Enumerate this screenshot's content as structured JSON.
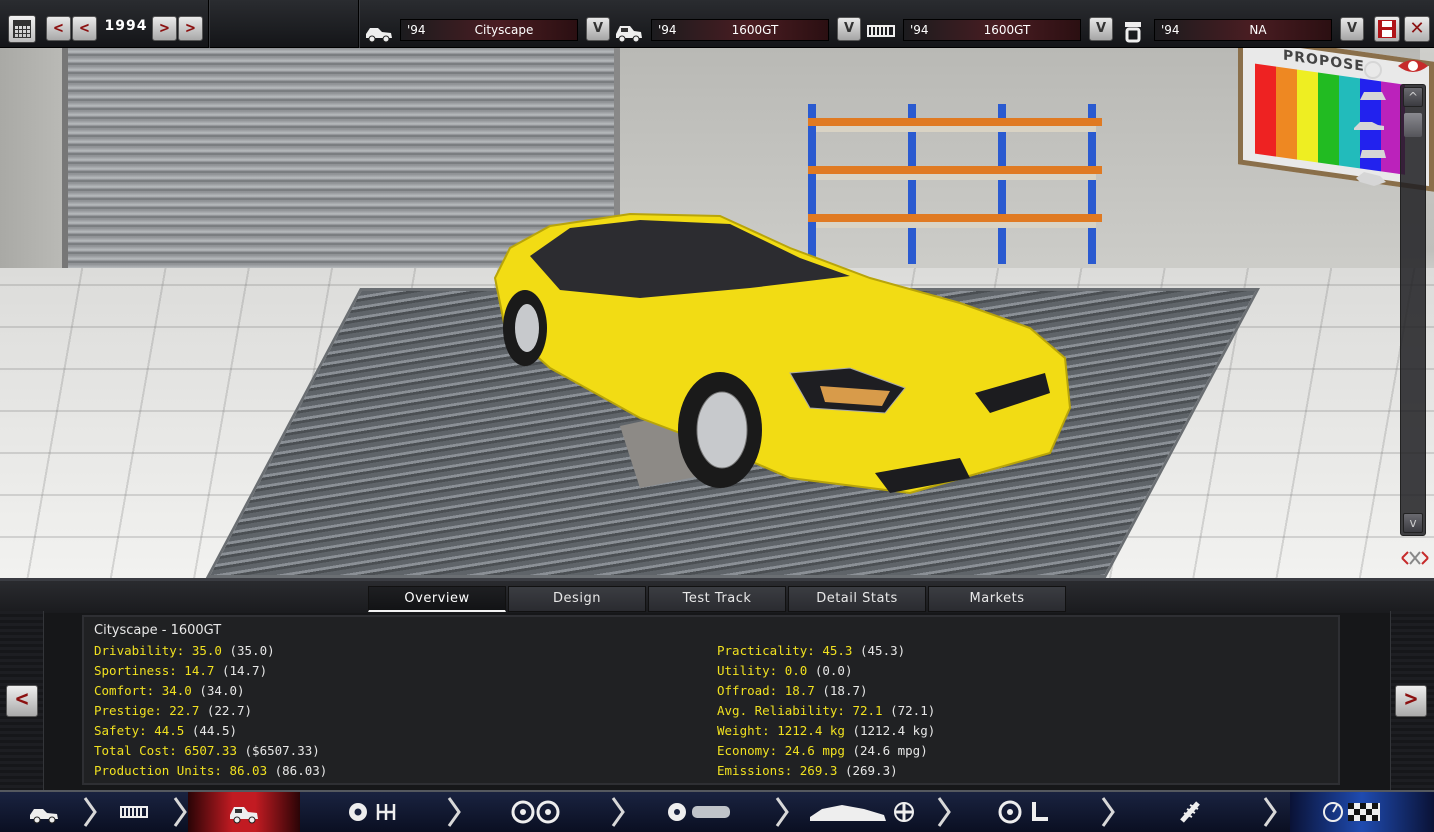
{
  "toolbar": {
    "year": "1994",
    "prev_year_fast": "<",
    "prev_year": "<",
    "next_year": ">",
    "next_year_fast": ">",
    "selectors": [
      {
        "icon": "car-body-icon",
        "year": "'94",
        "name": "Cityscape",
        "v": "V"
      },
      {
        "icon": "trim-icon",
        "year": "'94",
        "name": "1600GT",
        "v": "V"
      },
      {
        "icon": "chassis-icon",
        "year": "'94",
        "name": "1600GT",
        "v": "V"
      },
      {
        "icon": "engine-icon",
        "year": "'94",
        "name": "NA",
        "v": "V"
      }
    ],
    "close_label": "✕"
  },
  "viewport": {
    "poster_text": "PROPOSE",
    "scroll_up": "^",
    "scroll_down": "v",
    "car_color": "#f2dc14"
  },
  "tabs": [
    {
      "label": "Overview",
      "active": true
    },
    {
      "label": "Design"
    },
    {
      "label": "Test Track"
    },
    {
      "label": "Detail Stats"
    },
    {
      "label": "Markets"
    }
  ],
  "panel": {
    "prev": "<",
    "next": ">",
    "title": "Cityscape - 1600GT",
    "stats_left": [
      {
        "k": "Drivability: 35.0",
        "p": " (35.0)"
      },
      {
        "k": "Sportiness: 14.7",
        "p": " (14.7)"
      },
      {
        "k": "Comfort: 34.0",
        "p": " (34.0)"
      },
      {
        "k": "Prestige: 22.7",
        "p": " (22.7)"
      },
      {
        "k": "Safety: 44.5",
        "p": " (44.5)"
      },
      {
        "k": "Total Cost: 6507.33",
        "p": " ($6507.33)"
      },
      {
        "k": "Production Units: 86.03",
        "p": " (86.03)"
      }
    ],
    "stats_right": [
      {
        "k": "Practicality: 45.3",
        "p": " (45.3)"
      },
      {
        "k": "Utility: 0.0",
        "p": " (0.0)"
      },
      {
        "k": "Offroad: 18.7",
        "p": " (18.7)"
      },
      {
        "k": "Avg. Reliability: 72.1",
        "p": " (72.1)"
      },
      {
        "k": "Weight: 1212.4 kg",
        "p": " (1212.4 kg)"
      },
      {
        "k": "Economy: 24.6 mpg",
        "p": " (24.6 mpg)"
      },
      {
        "k": "Emissions: 269.3",
        "p": " (269.3)"
      }
    ]
  },
  "bottom_nav": [
    {
      "name": "vehicle",
      "icon": "car-side-icon"
    },
    {
      "name": "chassis",
      "icon": "chassis-icon"
    },
    {
      "name": "body",
      "icon": "car-body-icon",
      "active": true
    },
    {
      "name": "engine-gearbox",
      "icon": "gear-shift-icon"
    },
    {
      "name": "wheels",
      "icon": "wheels-icon"
    },
    {
      "name": "tires-fuel",
      "icon": "tire-tank-icon"
    },
    {
      "name": "aero-cooling",
      "icon": "sports-car-fan-icon"
    },
    {
      "name": "interior",
      "icon": "steering-seat-icon"
    },
    {
      "name": "suspension",
      "icon": "shock-absorber-icon"
    },
    {
      "name": "testing",
      "icon": "gauge-flag-icon"
    }
  ],
  "colors": {
    "accent_red": "#8b1010",
    "stat_yellow": "#f0e020",
    "nav_active": "#c21b22",
    "nav_blue": "#1f4bb0"
  }
}
